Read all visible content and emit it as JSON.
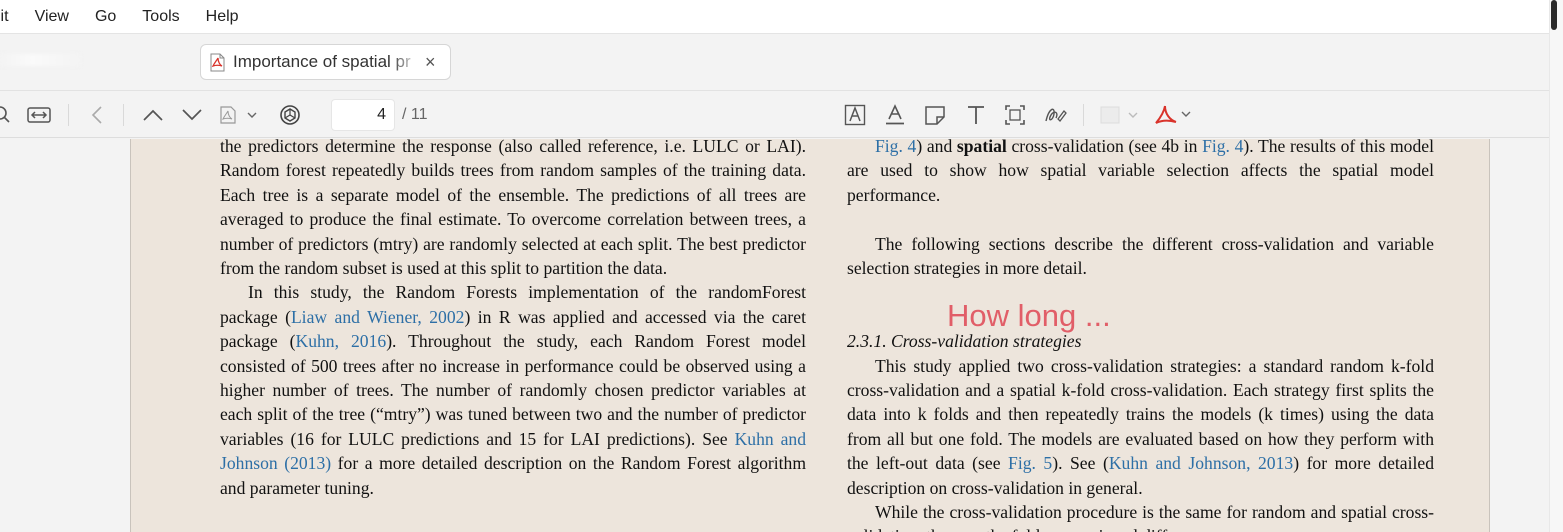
{
  "menu": [
    "lit",
    "View",
    "Go",
    "Tools",
    "Help"
  ],
  "tabs": {
    "active_title": "Importance of spatial pr",
    "close_glyph": "×"
  },
  "toolbar": {
    "current_page": "4",
    "total_pages": "/ 11"
  },
  "overlay_text": "How long ...",
  "left_column": {
    "p1": "the predictors determine the response (also called reference, i.e. LULC or LAI). Random forest repeatedly builds trees from random samples of the training data. Each tree is a separate model of the ensemble. The predictions of all trees are averaged to produce the final estimate. To overcome correlation between trees, a number of predictors (mtry) are randomly selected at each split. The best predictor from the random subset is used at this split to partition the data.",
    "p2_a": "In this study, the Random Forests implementation of the randomForest package (",
    "p2_link1": "Liaw and Wiener, 2002",
    "p2_b": ") in R was applied and accessed via the caret package (",
    "p2_link2": "Kuhn, 2016",
    "p2_c": "). Throughout the study, each Random Forest model consisted of 500 trees after no increase in performance could be observed using a higher number of trees. The number of randomly chosen predictor variables at each split of the tree (“mtry”) was tuned between two and the number of predictor variables (16 for LULC predictions and 15 for LAI predictions). See ",
    "p2_link3": "Kuhn and Johnson (2013)",
    "p2_d": " for a more detailed description on the Random Forest algorithm and parameter tuning."
  },
  "right_column": {
    "p1_link1": "Fig. 4",
    "p1_a": ") and ",
    "p1_bold": "spatial",
    "p1_b": " cross-validation (see 4b in ",
    "p1_link2": "Fig. 4",
    "p1_c": "). The results of this model are used to show how spatial variable selection affects the spatial model performance.",
    "p2": "The following sections describe the different cross-validation and variable selection strategies in more detail.",
    "heading": "2.3.1.  Cross-validation strategies",
    "p3_a": "This study applied two cross-validation strategies: a standard random k-fold cross-validation and a spatial k-fold cross-validation. Each strategy first splits the data into k folds and then repeatedly trains the models (k times) using the data from all but one fold. The models are evaluated based on how they perform with the left-out data (see ",
    "p3_link1": "Fig. 5",
    "p3_b": "). See (",
    "p3_link2": "Kuhn and Johnson, 2013",
    "p3_c": ") for more detailed description on cross-validation in general.",
    "p4": "While the cross-validation procedure is the same for random and spatial cross-validation, the way the folds are assigned differs."
  },
  "colors": {
    "page_bg": "#ede5dc",
    "link": "#2d6fa6",
    "overlay": "#e0505c",
    "acrobat_red": "#d9332b"
  }
}
